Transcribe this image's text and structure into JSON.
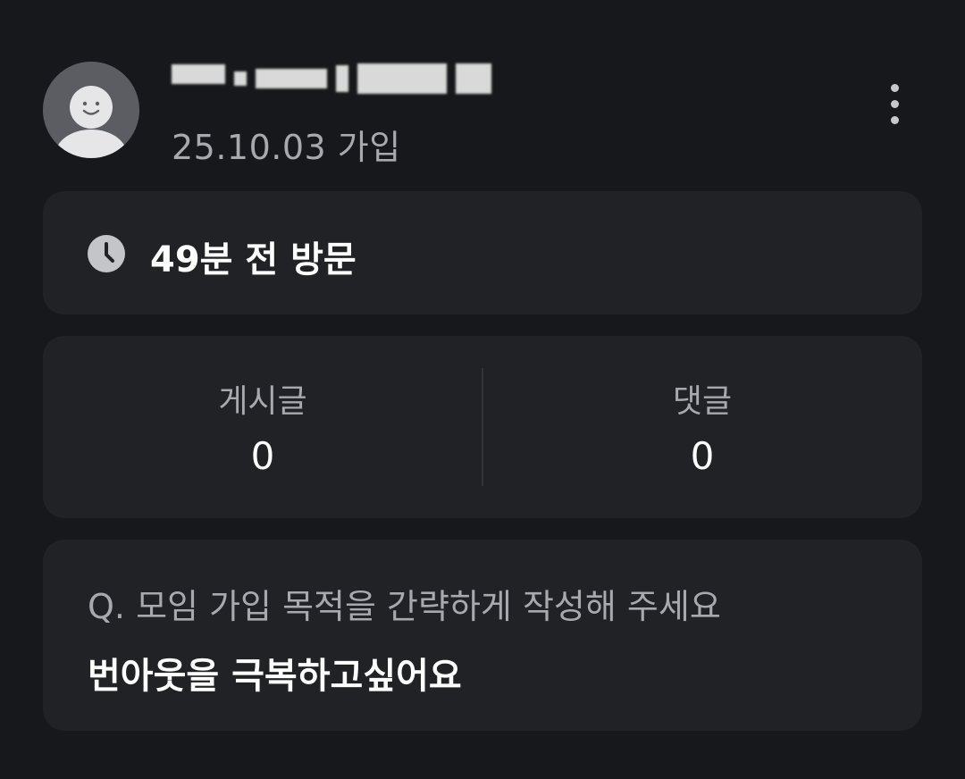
{
  "profile": {
    "joined_text": "25.10.03 가입",
    "username_redacted": true
  },
  "header": {
    "more_icon": "more-vertical-icon"
  },
  "visit": {
    "icon": "clock-icon",
    "text": "49분 전 방문"
  },
  "stats": {
    "posts_label": "게시글",
    "posts_value": "0",
    "comments_label": "댓글",
    "comments_value": "0"
  },
  "qa": {
    "question": "Q. 모임 가입 목적을 간략하게 작성해 주세요",
    "answer": "번아웃을 극복하고싶어요"
  },
  "colors": {
    "background": "#17181b",
    "card": "#202226",
    "muted_text": "#a7a9ae",
    "primary_text": "#ffffff"
  }
}
